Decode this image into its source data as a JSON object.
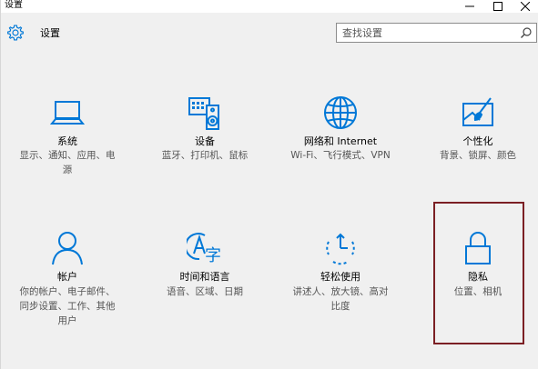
{
  "window": {
    "title": "设置",
    "controls": [
      "minimize",
      "maximize",
      "close"
    ]
  },
  "header": {
    "icon": "gear-icon",
    "title": "设置"
  },
  "search": {
    "placeholder": "查找设置",
    "value": "",
    "icon": "search-icon"
  },
  "accent_color": "#0078d7",
  "selection_border_color": "#7b1f24",
  "tiles": [
    {
      "title": "系统",
      "desc_lines": [
        "显示、通知、应用、电",
        "源"
      ],
      "icon": "laptop-icon",
      "selected": false
    },
    {
      "title": "设备",
      "desc_lines": [
        "蓝牙、打印机、鼠标"
      ],
      "icon": "devices-icon",
      "selected": false
    },
    {
      "title": "网络和 Internet",
      "desc_lines": [
        "Wi-Fi、飞行模式、VPN"
      ],
      "icon": "globe-icon",
      "selected": false
    },
    {
      "title": "个性化",
      "desc_lines": [
        "背景、锁屏、颜色"
      ],
      "icon": "personalization-icon",
      "selected": false
    },
    {
      "title": "帐户",
      "desc_lines": [
        "你的帐户、电子邮件、",
        "同步设置、工作、其他",
        "用户"
      ],
      "icon": "person-icon",
      "selected": false
    },
    {
      "title": "时间和语言",
      "desc_lines": [
        "语音、区域、日期"
      ],
      "icon": "time-language-icon",
      "selected": false
    },
    {
      "title": "轻松使用",
      "desc_lines": [
        "讲述人、放大镜、高对",
        "比度"
      ],
      "icon": "ease-of-access-icon",
      "selected": false
    },
    {
      "title": "隐私",
      "desc_lines": [
        "位置、相机"
      ],
      "icon": "lock-icon",
      "selected": true
    }
  ]
}
